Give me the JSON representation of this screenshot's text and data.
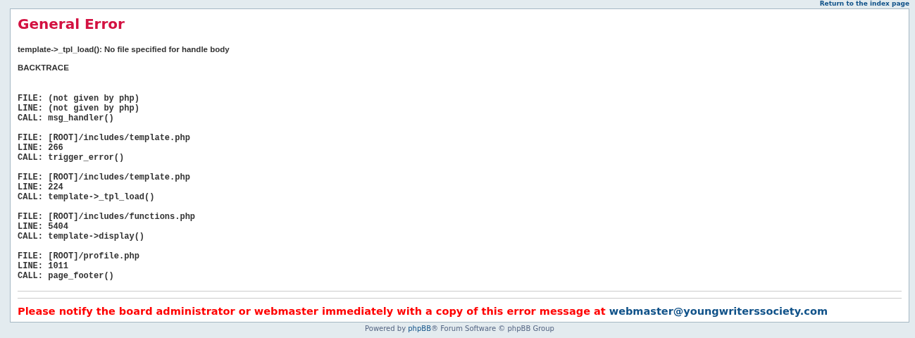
{
  "top_link": "Return to the index page",
  "title": "General Error",
  "message": "template->_tpl_load(): No file specified for handle body",
  "backtrace_heading": "BACKTRACE",
  "backtrace": [
    {
      "file": "FILE: (not given by php)",
      "line": "LINE: (not given by php)",
      "call": "CALL: msg_handler()"
    },
    {
      "file": "FILE: [ROOT]/includes/template.php",
      "line": "LINE: 266",
      "call": "CALL: trigger_error()"
    },
    {
      "file": "FILE: [ROOT]/includes/template.php",
      "line": "LINE: 224",
      "call": "CALL: template->_tpl_load()"
    },
    {
      "file": "FILE: [ROOT]/includes/functions.php",
      "line": "LINE: 5404",
      "call": "CALL: template->display()"
    },
    {
      "file": "FILE: [ROOT]/profile.php",
      "line": "LINE: 1011",
      "call": "CALL: page_footer()"
    }
  ],
  "notice": "Please notify the board administrator or webmaster immediately with a copy of this error message at",
  "notice_email": "webmaster@youngwriterssociety.com",
  "footer": {
    "prefix": "Powered by",
    "link": "phpBB",
    "suffix": "® Forum Software © phpBB Group"
  }
}
